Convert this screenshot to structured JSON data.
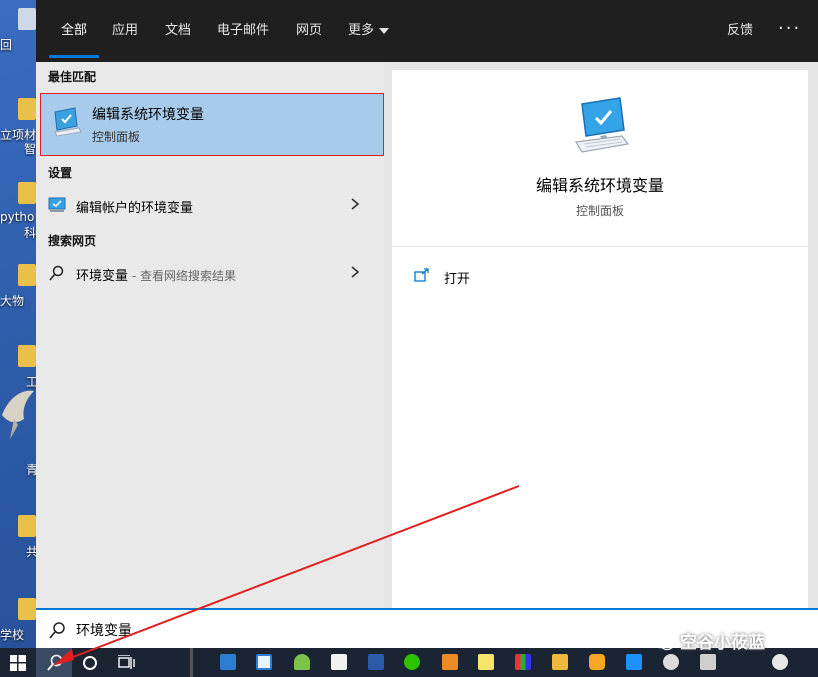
{
  "tabs": [
    {
      "label": "全部",
      "active": true
    },
    {
      "label": "应用"
    },
    {
      "label": "文档"
    },
    {
      "label": "电子邮件"
    },
    {
      "label": "网页"
    },
    {
      "label": "更多"
    }
  ],
  "header": {
    "feedback_label": "反馈",
    "more_options_label": "···"
  },
  "best_match": {
    "section_label": "最佳匹配",
    "title": "编辑系统环境变量",
    "subtitle": "控制面板",
    "icon": "control-panel-monitor-icon"
  },
  "settings": {
    "section_label": "设置",
    "items": [
      {
        "label": "编辑帐户的环境变量",
        "icon": "settings-monitor-icon"
      }
    ]
  },
  "web": {
    "section_label": "搜索网页",
    "items": [
      {
        "label": "环境变量",
        "suffix": " - 查看网络搜索结果",
        "icon": "search-icon"
      }
    ]
  },
  "detail": {
    "title": "编辑系统环境变量",
    "subtitle": "控制面板",
    "actions": [
      {
        "label": "打开",
        "icon": "open-icon"
      }
    ]
  },
  "search": {
    "value": "环境变量"
  },
  "desktop_icons": [
    "回",
    "立项材",
    "智",
    "pytho",
    "科",
    "大物",
    "工",
    "青",
    "共",
    "学校"
  ],
  "watermark": "空谷小莜蓝",
  "colors": {
    "accent": "#0078d7",
    "selection": "#a8cbec",
    "annotation": "#e02020",
    "taskbar": "#1b2432"
  }
}
